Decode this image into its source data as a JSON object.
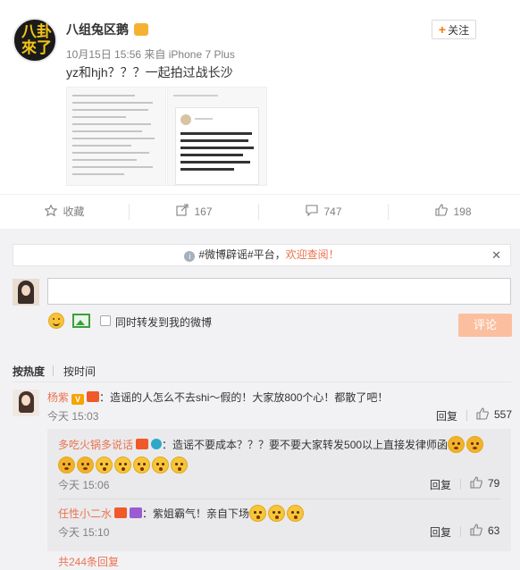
{
  "post": {
    "author": "八组兔区鹅",
    "avatar_text": [
      "八",
      "卦",
      "來",
      "了"
    ],
    "time": "10月15日 15:56",
    "source_prefix": "来自",
    "source": "iPhone 7 Plus",
    "text": "yz和hjh？？？一起拍过战长沙",
    "follow_label": "关注"
  },
  "actions": {
    "favorite": "收藏",
    "repost_count": "167",
    "comment_count": "747",
    "like_count": "198"
  },
  "comment_box": {
    "notice_text": "#微博辟谣#平台，",
    "notice_link": "欢迎查阅！",
    "input_value": "",
    "repost_label": "同时转发到我的微博",
    "submit_label": "评论"
  },
  "sort": {
    "by_hot": "按热度",
    "by_time": "按时间"
  },
  "comments": [
    {
      "user": "杨紫",
      "text": "：造谣的人怎么不去shi～假的！大家放800个心！都散了吧！",
      "time": "今天 15:03",
      "reply_label": "回复",
      "likes": "557",
      "replies": [
        {
          "user": "多吃火锅多说话",
          "text": "：造谣不要成本？？？要不要大家转发500以上直接发律师函",
          "time": "今天 15:06",
          "reply_label": "回复",
          "likes": "79"
        },
        {
          "user": "任性小二水",
          "text": "：紫姐霸气！亲自下场",
          "time": "今天 15:10",
          "reply_label": "回复",
          "likes": "63"
        }
      ],
      "more_label": "共244条回复"
    }
  ],
  "colors": {
    "accent": "#eb7350",
    "submit_disabled": "#fbbf9f",
    "muted": "#808080"
  },
  "icons": [
    "star-icon",
    "repost-icon",
    "comment-icon",
    "thumbs-up-icon",
    "info-icon",
    "close-icon",
    "emoji-icon",
    "image-icon",
    "plus-icon"
  ]
}
